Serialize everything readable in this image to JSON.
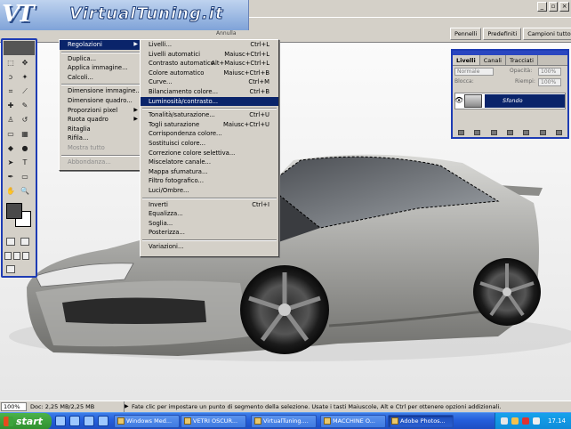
{
  "app": {
    "logo_text": "VirtualTuning.it",
    "options_tabs": [
      "Pennelli",
      "Predefiniti",
      "Campioni tutto"
    ],
    "top_fragment": "Annulla"
  },
  "menu_image": {
    "items": [
      {
        "label": "Regolazioni",
        "submenu": true,
        "highlighted": true
      },
      {
        "sep": true
      },
      {
        "label": "Duplica..."
      },
      {
        "label": "Applica immagine..."
      },
      {
        "label": "Calcoli..."
      },
      {
        "sep": true
      },
      {
        "label": "Dimensione immagine..."
      },
      {
        "label": "Dimensione quadro..."
      },
      {
        "label": "Proporzioni pixel",
        "submenu": true
      },
      {
        "label": "Ruota quadro",
        "submenu": true
      },
      {
        "label": "Ritaglia"
      },
      {
        "label": "Rifila..."
      },
      {
        "label": "Mostra tutto",
        "disabled": true
      },
      {
        "sep": true
      },
      {
        "label": "Abbondanza...",
        "disabled": true
      }
    ]
  },
  "menu_adjustments": {
    "items": [
      {
        "label": "Livelli...",
        "shortcut": "Ctrl+L"
      },
      {
        "label": "Livelli automatici",
        "shortcut": "Maiusc+Ctrl+L"
      },
      {
        "label": "Contrasto automatico",
        "shortcut": "Alt+Maiusc+Ctrl+L"
      },
      {
        "label": "Colore automatico",
        "shortcut": "Maiusc+Ctrl+B"
      },
      {
        "label": "Curve...",
        "shortcut": "Ctrl+M"
      },
      {
        "label": "Bilanciamento colore...",
        "shortcut": "Ctrl+B"
      },
      {
        "label": "Luminosità/contrasto...",
        "highlighted": true
      },
      {
        "sep": true
      },
      {
        "label": "Tonalità/saturazione...",
        "shortcut": "Ctrl+U"
      },
      {
        "label": "Togli saturazione",
        "shortcut": "Maiusc+Ctrl+U"
      },
      {
        "label": "Corrispondenza colore..."
      },
      {
        "label": "Sostituisci colore..."
      },
      {
        "label": "Correzione colore selettiva..."
      },
      {
        "label": "Miscelatore canale..."
      },
      {
        "label": "Mappa sfumatura..."
      },
      {
        "label": "Filtro fotografico..."
      },
      {
        "label": "Luci/Ombre..."
      },
      {
        "sep": true
      },
      {
        "label": "Inverti",
        "shortcut": "Ctrl+I"
      },
      {
        "label": "Equalizza..."
      },
      {
        "label": "Soglia..."
      },
      {
        "label": "Posterizza..."
      },
      {
        "sep": true
      },
      {
        "label": "Variazioni..."
      }
    ]
  },
  "layers_panel": {
    "tabs": [
      "Livelli",
      "Canali",
      "Tracciati"
    ],
    "blend_mode": "Normale",
    "opacity_label": "Opacità:",
    "opacity_value": "100%",
    "lock_label": "Blocca:",
    "fill_label": "Riempi:",
    "fill_value": "100%",
    "layer_name": "Sfondo"
  },
  "status": {
    "zoom": "100%",
    "doc": "Doc: 2,25 MB/2,25 MB",
    "hint": "Fate clic per impostare un punto di segmento della selezione.  Usate i tasti Maiuscole, Alt e Ctrl per ottenere opzioni addizionali."
  },
  "taskbar": {
    "start_label": "start",
    "tasks": [
      "Windows Med...",
      "VETRI OSCUR...",
      "VirtualTuning....",
      "MACCHINE O...",
      "Adobe Photos..."
    ],
    "active_task": 4,
    "clock": "17.14"
  },
  "colors": {
    "menu_highlight": "#0a246a",
    "palette_border": "#1e3cb4",
    "taskbar": "#245edb",
    "start_button": "#3c9c3c"
  }
}
